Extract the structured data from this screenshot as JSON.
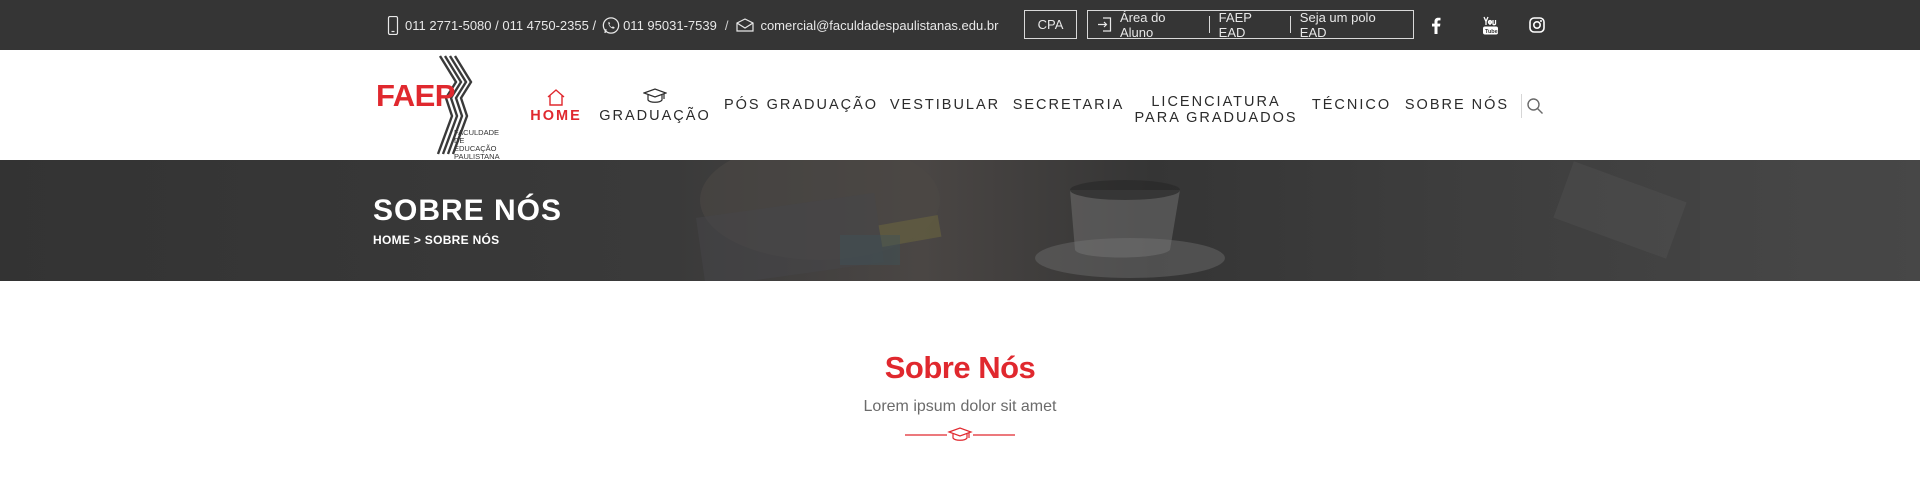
{
  "topbar": {
    "phones": "011 2771-5080 / 011 4750-2355 /",
    "whatsapp": "011 95031-7539",
    "slash": "/",
    "email": "comercial@faculdadespaulistanas.edu.br",
    "cpa": "CPA",
    "area_aluno": "Área do Aluno",
    "faep_ead": "FAEP EAD",
    "polo": "Seja um polo EAD",
    "icons": [
      "phone-icon",
      "whatsapp-icon",
      "mail-icon",
      "login-icon",
      "facebook-icon",
      "youtube-icon",
      "instagram-icon"
    ]
  },
  "logo": {
    "text": "FAEP",
    "subtitle": "FACULDADE DE\nEDUCAÇÃO\nPAULISTANA"
  },
  "nav": {
    "home": "HOME",
    "graduacao": "GRADUAÇÃO",
    "pos": "PÓS GRADUAÇÃO",
    "vestibular": "VESTIBULAR",
    "secretaria": "SECRETARIA",
    "licenciatura_1": "LICENCIATURA",
    "licenciatura_2": "PARA GRADUADOS",
    "tecnico": "TÉCNICO",
    "sobre": "SOBRE NÓS"
  },
  "banner": {
    "title": "SOBRE NÓS",
    "breadcrumb": "HOME > SOBRE NÓS"
  },
  "section": {
    "title": "Sobre Nós",
    "subtitle": "Lorem ipsum dolor sit amet"
  },
  "colors": {
    "accent": "#e0282e",
    "topbar": "#353535",
    "banner": "#3a3a3a"
  }
}
